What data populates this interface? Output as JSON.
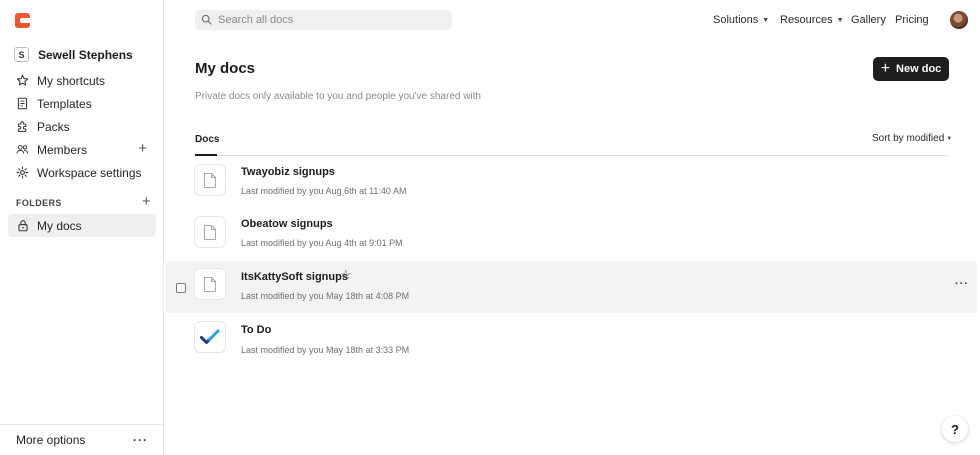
{
  "workspace": {
    "avatar_letter": "S",
    "name": "Sewell Stephens"
  },
  "sidebar": {
    "items": [
      {
        "label": "My shortcuts",
        "icon": "star-icon"
      },
      {
        "label": "Templates",
        "icon": "templates-icon"
      },
      {
        "label": "Packs",
        "icon": "puzzle-icon"
      },
      {
        "label": "Members",
        "icon": "members-icon"
      },
      {
        "label": "Workspace settings",
        "icon": "gear-icon"
      }
    ],
    "folders_header": "FOLDERS",
    "folders": [
      {
        "label": "My docs",
        "icon": "lock-icon",
        "active": true
      }
    ],
    "more_options": "More options"
  },
  "topbar": {
    "search_placeholder": "Search all docs",
    "nav": [
      "Solutions",
      "Resources",
      "Gallery",
      "Pricing"
    ]
  },
  "main": {
    "title": "My docs",
    "subtitle": "Private docs only available to you and people you've shared with",
    "new_doc_label": "New doc",
    "tab": "Docs",
    "sort_label": "Sort by modified",
    "docs": [
      {
        "title": "Twayobiz signups",
        "meta": "Last modified by you Aug 6th at 11:40 AM",
        "icon": "doc-icon"
      },
      {
        "title": "Obeatow signups",
        "meta": "Last modified by you Aug 4th at 9:01 PM",
        "icon": "doc-icon"
      },
      {
        "title": "ItsKattySoft signups",
        "meta": "Last modified by you May 18th at 4:08 PM",
        "icon": "doc-icon",
        "hovered": true
      },
      {
        "title": "To Do",
        "meta": "Last modified by you May 18th at 3:33 PM",
        "icon": "checkmark-icon"
      }
    ]
  },
  "help_label": "?",
  "colors": {
    "brand": "#f2542d",
    "checkmark_dark": "#1a3b8c",
    "checkmark_light": "#2a9df4"
  }
}
